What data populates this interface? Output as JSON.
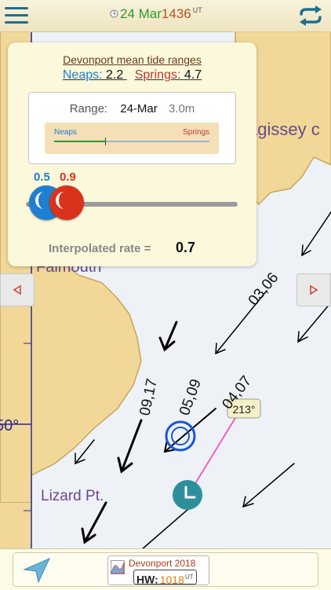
{
  "header": {
    "date": "24 Mar",
    "time": "1436",
    "time_zone": "UT"
  },
  "panel": {
    "title": "Devonport mean tide ranges",
    "neaps_label": "Neaps:",
    "neaps_value": "2.2",
    "springs_label": "Springs:",
    "springs_value": "4.7",
    "range_label": "Range:",
    "range_date": "24-Mar",
    "range_value": "3.0m",
    "bar_neaps": "Neaps",
    "bar_springs": "Springs",
    "range_position_fraction": 0.33,
    "neap_rate": "0.5",
    "spring_rate": "0.9",
    "interpolated_label": "Interpolated rate =",
    "interpolated_value": "0.7"
  },
  "map": {
    "place_mevagissey": "agissey c",
    "place_falmouth": "Falmouth",
    "place_lizard": "Lizard Pt.",
    "latitude_label": "50°",
    "stream_labels": [
      "03,06",
      "05,09",
      "04,07",
      "09,17"
    ],
    "bearing": "213°"
  },
  "footer": {
    "port_name": "Devonport 2018",
    "hw_label": "HW:",
    "hw_time": "1018",
    "hw_zone": "UT"
  },
  "colors": {
    "sea": "#eef2f7",
    "land": "#f1d899",
    "neaps": "#1e7fd0",
    "springs": "#d9331c",
    "accent": "#1d6f93"
  }
}
